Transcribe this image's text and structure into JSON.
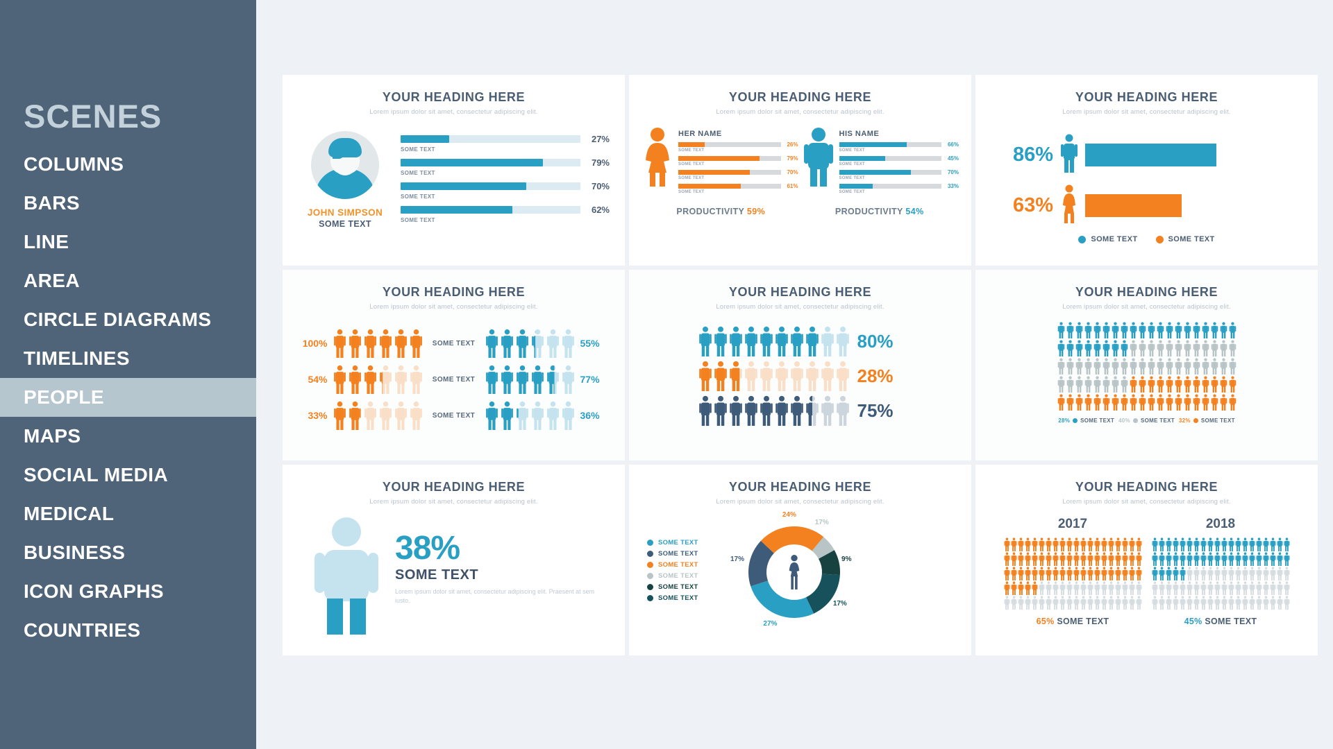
{
  "sidebar": {
    "title": "SCENES",
    "items": [
      {
        "label": "COLUMNS",
        "active": false
      },
      {
        "label": "BARS",
        "active": false
      },
      {
        "label": "LINE",
        "active": false
      },
      {
        "label": "AREA",
        "active": false
      },
      {
        "label": "CIRCLE DIAGRAMS",
        "active": false
      },
      {
        "label": "TIMELINES",
        "active": false
      },
      {
        "label": "PEOPLE",
        "active": true
      },
      {
        "label": "MAPS",
        "active": false
      },
      {
        "label": "SOCIAL MEDIA",
        "active": false
      },
      {
        "label": "MEDICAL",
        "active": false
      },
      {
        "label": "BUSINESS",
        "active": false
      },
      {
        "label": "ICON GRAPHS",
        "active": false
      },
      {
        "label": "COUNTRIES",
        "active": false
      }
    ]
  },
  "colors": {
    "blue": "#2a9fc4",
    "blue_light": "#c5e3ef",
    "orange": "#f3811f",
    "orange_light": "#fadfc8",
    "navy": "#3f5b7a",
    "navy_light": "#c7d0d8",
    "gray": "#b8c4c6",
    "gray_light": "#dde3e6",
    "teal_dark": "#17525c",
    "green_dark": "#17423f",
    "sidebar_bg": "#4f6479",
    "page_bg": "#eef1f6",
    "heading": "#4a5d72"
  },
  "common": {
    "heading": "YOUR HEADING HERE",
    "subheading": "Lorem ipsum dolor sit amet, consectetur adipiscing elit.",
    "some_text": "SOME TEXT"
  },
  "cards": {
    "card1": {
      "heading": "YOUR HEADING HERE",
      "subheading": "Lorem ipsum dolor sit amet, consectetur adipiscing elit.",
      "person_name": "JOHN SIMPSON",
      "person_role": "SOME TEXT",
      "chart_data": {
        "type": "bar",
        "title": "YOUR HEADING HERE",
        "categories": [
          "SOME TEXT",
          "SOME TEXT",
          "SOME TEXT",
          "SOME TEXT"
        ],
        "values": [
          27,
          79,
          70,
          62
        ],
        "labels": [
          "27%",
          "79%",
          "70%",
          "62%"
        ],
        "xlabel": "",
        "ylabel": "",
        "ylim": [
          0,
          100
        ],
        "color": "#2a9fc4",
        "track_color": "#dceaf2",
        "grid": false,
        "legend": "none"
      }
    },
    "card2": {
      "heading": "YOUR HEADING HERE",
      "subheading": "Lorem ipsum dolor sit amet, consectetur adipiscing elit.",
      "her": {
        "title": "HER NAME",
        "productivity_label": "PRODUCTIVITY",
        "productivity_value": "59%"
      },
      "his": {
        "title": "HIS NAME",
        "productivity_label": "PRODUCTIVITY",
        "productivity_value": "54%"
      },
      "chart_data": {
        "type": "bar",
        "title": "YOUR HEADING HERE",
        "categories": [
          "SOME TEXT",
          "SOME TEXT",
          "SOME TEXT",
          "SOME TEXT"
        ],
        "series": [
          {
            "name": "HER NAME",
            "values": [
              26,
              79,
              70,
              61
            ],
            "labels": [
              "26%",
              "79%",
              "70%",
              "61%"
            ],
            "color": "#f3811f"
          },
          {
            "name": "HIS NAME",
            "values": [
              66,
              45,
              70,
              33
            ],
            "labels": [
              "66%",
              "45%",
              "70%",
              "33%"
            ],
            "color": "#2a9fc4"
          }
        ],
        "ylim": [
          0,
          100
        ],
        "grid": false,
        "legend": "bottom"
      }
    },
    "card3": {
      "heading": "YOUR HEADING HERE",
      "subheading": "Lorem ipsum dolor sit amet, consectetur adipiscing elit.",
      "legend": [
        {
          "label": "SOME TEXT",
          "color": "#2a9fc4"
        },
        {
          "label": "SOME TEXT",
          "color": "#f3811f"
        }
      ],
      "chart_data": {
        "type": "bar",
        "title": "YOUR HEADING HERE",
        "categories": [
          "SOME TEXT",
          "SOME TEXT"
        ],
        "values": [
          86,
          63
        ],
        "labels": [
          "86%",
          "63%"
        ],
        "colors": [
          "#2a9fc4",
          "#f3811f"
        ],
        "icons": [
          "male",
          "female"
        ],
        "ylim": [
          0,
          100
        ],
        "grid": false,
        "legend": "bottom"
      }
    },
    "card4": {
      "heading": "YOUR HEADING HERE",
      "subheading": "Lorem ipsum dolor sit amet, consectetur adipiscing elit.",
      "chart_data": {
        "type": "pictogram",
        "title": "YOUR HEADING HERE",
        "icons_per_row": 6,
        "categories": [
          "SOME TEXT",
          "SOME TEXT",
          "SOME TEXT"
        ],
        "series": [
          {
            "name": "left",
            "values": [
              100,
              54,
              33
            ],
            "labels": [
              "100%",
              "54%",
              "33%"
            ],
            "color": "#f3811f",
            "muted": "#fadfc8"
          },
          {
            "name": "right",
            "values": [
              55,
              77,
              36
            ],
            "labels": [
              "55%",
              "77%",
              "36%"
            ],
            "color": "#2a9fc4",
            "muted": "#c5e3ef"
          }
        ]
      }
    },
    "card5": {
      "heading": "YOUR HEADING HERE",
      "subheading": "Lorem ipsum dolor sit amet, consectetur adipiscing elit.",
      "chart_data": {
        "type": "pictogram",
        "title": "YOUR HEADING HERE",
        "icons_per_row": 10,
        "values": [
          80,
          28,
          75
        ],
        "labels": [
          "80%",
          "28%",
          "75%"
        ],
        "colors": [
          "#2a9fc4",
          "#f3811f",
          "#3f5b7a"
        ],
        "muted_colors": [
          "#c5e3ef",
          "#fadfc8",
          "#ccd4dc"
        ]
      }
    },
    "card6": {
      "heading": "YOUR HEADING HERE",
      "subheading": "Lorem ipsum dolor sit amet, consectetur adipiscing elit.",
      "legend": [
        {
          "pct": "28%",
          "label": "SOME TEXT",
          "color": "#2a9fc4"
        },
        {
          "pct": "40%",
          "label": "SOME TEXT",
          "color": "#b8c4c6"
        },
        {
          "pct": "32%",
          "label": "SOME TEXT",
          "color": "#f3811f"
        }
      ],
      "chart_data": {
        "type": "pictogram",
        "title": "YOUR HEADING HERE",
        "total_icons": 100,
        "columns": 20,
        "rows": 5,
        "segments": [
          {
            "name": "SOME TEXT",
            "value": 28,
            "color": "#2a9fc4"
          },
          {
            "name": "SOME TEXT",
            "value": 40,
            "color": "#b8c4c6"
          },
          {
            "name": "SOME TEXT",
            "value": 32,
            "color": "#f3811f"
          }
        ]
      }
    },
    "card7": {
      "heading": "YOUR HEADING HERE",
      "subheading": "Lorem ipsum dolor sit amet, consectetur adipiscing elit.",
      "big_value": "38%",
      "big_label": "SOME TEXT",
      "body_text": "Lorem ipsum dolor sit amet, consectetur adipiscing elit. Praesent at sem iusto.",
      "chart_data": {
        "type": "pictogram",
        "title": "YOUR HEADING HERE",
        "values": [
          38
        ],
        "labels": [
          "38%"
        ],
        "color": "#2a9fc4",
        "muted_color": "#c5e3ef"
      }
    },
    "card8": {
      "heading": "YOUR HEADING HERE",
      "subheading": "Lorem ipsum dolor sit amet, consectetur adipiscing elit.",
      "legend": [
        {
          "label": "SOME TEXT",
          "color": "#2a9fc4"
        },
        {
          "label": "SOME TEXT",
          "color": "#3f5b7a"
        },
        {
          "label": "SOME TEXT",
          "color": "#f3811f"
        },
        {
          "label": "SOME TEXT",
          "color": "#b8c4c6"
        },
        {
          "label": "SOME TEXT",
          "color": "#17423f"
        },
        {
          "label": "SOME TEXT",
          "color": "#17525c"
        }
      ],
      "chart_data": {
        "type": "pie",
        "title": "YOUR HEADING HERE",
        "donut": true,
        "labels": [
          "SOME TEXT",
          "SOME TEXT",
          "SOME TEXT",
          "SOME TEXT",
          "SOME TEXT",
          "SOME TEXT"
        ],
        "values": [
          17,
          9,
          17,
          27,
          17,
          24
        ],
        "value_labels": [
          "17%",
          "9%",
          "17%",
          "27%",
          "17%",
          "24%"
        ],
        "colors": [
          "#b8c4c6",
          "#17423f",
          "#17525c",
          "#2a9fc4",
          "#3f5b7a",
          "#f3811f"
        ],
        "legend": "left"
      }
    },
    "card9": {
      "heading": "YOUR HEADING HERE",
      "subheading": "Lorem ipsum dolor sit amet, consectetur adipiscing elit.",
      "chart_data": {
        "type": "pictogram",
        "title": "YOUR HEADING HERE",
        "columns": 20,
        "rows": 5,
        "groups": [
          {
            "name": "2017",
            "value": 65,
            "label": "65%",
            "caption": "SOME TEXT",
            "color": "#f3811f",
            "muted": "#d6dde1"
          },
          {
            "name": "2018",
            "value": 45,
            "label": "45%",
            "caption": "SOME TEXT",
            "color": "#2a9fc4",
            "muted": "#d6dde1"
          }
        ]
      }
    }
  }
}
